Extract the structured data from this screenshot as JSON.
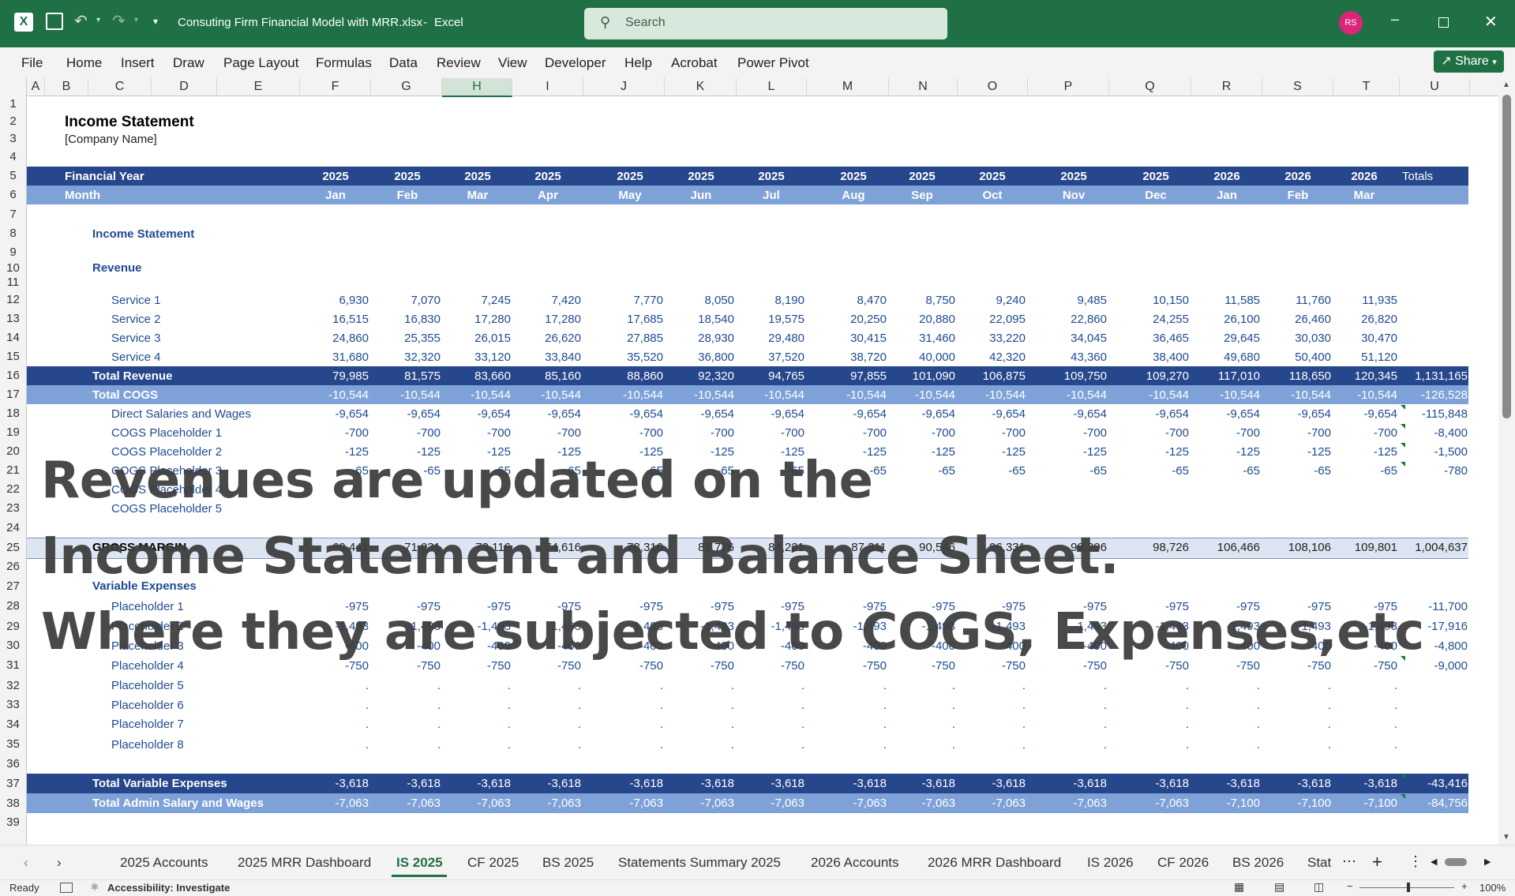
{
  "window": {
    "title": "Consuting Firm Financial Model with MRR.xlsx",
    "app": "Excel",
    "search_placeholder": "Search",
    "user_initials": "RS",
    "brand_color": "#1f7145"
  },
  "ribbon": {
    "tabs": [
      "File",
      "Home",
      "Insert",
      "Draw",
      "Page Layout",
      "Formulas",
      "Data",
      "Review",
      "View",
      "Developer",
      "Help",
      "Acrobat",
      "Power Pivot"
    ],
    "share_label": "Share"
  },
  "grid": {
    "columns": [
      "A",
      "B",
      "C",
      "D",
      "E",
      "F",
      "G",
      "H",
      "I",
      "J",
      "K",
      "L",
      "M",
      "N",
      "O",
      "P",
      "Q",
      "R",
      "S",
      "T",
      "U"
    ],
    "selected_column": "H",
    "rows": [
      "1",
      "2",
      "3",
      "4",
      "5",
      "6",
      "7",
      "8",
      "9",
      "10",
      "11",
      "12",
      "13",
      "14",
      "15",
      "16",
      "17",
      "18",
      "19",
      "20",
      "21",
      "22",
      "23",
      "24",
      "25",
      "26",
      "27",
      "28",
      "29",
      "30",
      "31",
      "32",
      "33",
      "34",
      "35",
      "36",
      "37",
      "38",
      "39"
    ]
  },
  "sheet": {
    "title": "Income Statement",
    "company": "[Company Name]",
    "fy_label": "Financial Year",
    "month_label": "Month",
    "years": [
      "2025",
      "2025",
      "2025",
      "2025",
      "2025",
      "2025",
      "2025",
      "2025",
      "2025",
      "2025",
      "2025",
      "2025",
      "2026",
      "2026",
      "2026"
    ],
    "months": [
      "Jan",
      "Feb",
      "Mar",
      "Apr",
      "May",
      "Jun",
      "Jul",
      "Aug",
      "Sep",
      "Oct",
      "Nov",
      "Dec",
      "Jan",
      "Feb",
      "Mar"
    ],
    "totals_label": "Totals",
    "section_income": "Income Statement",
    "section_revenue": "Revenue",
    "section_variable": "Variable Expenses"
  },
  "table": [
    {
      "label": "Service 1",
      "vals": [
        "6,930",
        "7,070",
        "7,245",
        "7,420",
        "7,770",
        "8,050",
        "8,190",
        "8,470",
        "8,750",
        "9,240",
        "9,485",
        "10,150",
        "11,585",
        "11,760",
        "11,935"
      ],
      "total": ""
    },
    {
      "label": "Service 2",
      "vals": [
        "16,515",
        "16,830",
        "17,280",
        "17,280",
        "17,685",
        "18,540",
        "19,575",
        "20,250",
        "20,880",
        "22,095",
        "22,860",
        "24,255",
        "26,100",
        "26,460",
        "26,820"
      ],
      "total": ""
    },
    {
      "label": "Service 3",
      "vals": [
        "24,860",
        "25,355",
        "26,015",
        "26,620",
        "27,885",
        "28,930",
        "29,480",
        "30,415",
        "31,460",
        "33,220",
        "34,045",
        "36,465",
        "29,645",
        "30,030",
        "30,470"
      ],
      "total": ""
    },
    {
      "label": "Service 4",
      "vals": [
        "31,680",
        "32,320",
        "33,120",
        "33,840",
        "35,520",
        "36,800",
        "37,520",
        "38,720",
        "40,000",
        "42,320",
        "43,360",
        "38,400",
        "49,680",
        "50,400",
        "51,120"
      ],
      "total": ""
    },
    {
      "label": "Total Revenue",
      "vals": [
        "79,985",
        "81,575",
        "83,660",
        "85,160",
        "88,860",
        "92,320",
        "94,765",
        "97,855",
        "101,090",
        "106,875",
        "109,750",
        "109,270",
        "117,010",
        "118,650",
        "120,345"
      ],
      "total": "1,131,165"
    },
    {
      "label": "Total COGS",
      "vals": [
        "-10,544",
        "-10,544",
        "-10,544",
        "-10,544",
        "-10,544",
        "-10,544",
        "-10,544",
        "-10,544",
        "-10,544",
        "-10,544",
        "-10,544",
        "-10,544",
        "-10,544",
        "-10,544",
        "-10,544"
      ],
      "total": "-126,528"
    },
    {
      "label": "Direct Salaries and Wages",
      "vals": [
        "-9,654",
        "-9,654",
        "-9,654",
        "-9,654",
        "-9,654",
        "-9,654",
        "-9,654",
        "-9,654",
        "-9,654",
        "-9,654",
        "-9,654",
        "-9,654",
        "-9,654",
        "-9,654",
        "-9,654"
      ],
      "total": "-115,848"
    },
    {
      "label": "COGS Placeholder 1",
      "vals": [
        "-700",
        "-700",
        "-700",
        "-700",
        "-700",
        "-700",
        "-700",
        "-700",
        "-700",
        "-700",
        "-700",
        "-700",
        "-700",
        "-700",
        "-700"
      ],
      "total": "-8,400"
    },
    {
      "label": "COGS Placeholder 2",
      "vals": [
        "-125",
        "-125",
        "-125",
        "-125",
        "-125",
        "-125",
        "-125",
        "-125",
        "-125",
        "-125",
        "-125",
        "-125",
        "-125",
        "-125",
        "-125"
      ],
      "total": "-1,500"
    },
    {
      "label": "COGS Placeholder 3",
      "vals": [
        "-65",
        "-65",
        "-65",
        "-65",
        "-65",
        "-65",
        "-65",
        "-65",
        "-65",
        "-65",
        "-65",
        "-65",
        "-65",
        "-65",
        "-65"
      ],
      "total": "-780"
    },
    {
      "label": "COGS Placeholder 4",
      "vals": [
        "",
        "",
        "",
        "",
        "",
        "",
        "",
        "",
        "",
        "",
        "",
        "",
        "",
        "",
        ""
      ],
      "total": ""
    },
    {
      "label": "COGS Placeholder 5",
      "vals": [
        "",
        "",
        "",
        "",
        "",
        "",
        "",
        "",
        "",
        "",
        "",
        "",
        "",
        "",
        ""
      ],
      "total": ""
    },
    {
      "label": "GROSS MARGIN",
      "vals": [
        "69,441",
        "71,031",
        "73,116",
        "74,616",
        "78,316",
        "81,776",
        "84,221",
        "87,311",
        "90,546",
        "96,331",
        "99,206",
        "98,726",
        "106,466",
        "108,106",
        "109,801"
      ],
      "total": "1,004,637"
    },
    {
      "label": "Placeholder 1",
      "vals": [
        "-975",
        "-975",
        "-975",
        "-975",
        "-975",
        "-975",
        "-975",
        "-975",
        "-975",
        "-975",
        "-975",
        "-975",
        "-975",
        "-975",
        "-975"
      ],
      "total": "-11,700"
    },
    {
      "label": "Placeholder 2",
      "vals": [
        "-1,493",
        "-1,493",
        "-1,493",
        "-1,493",
        "-1,493",
        "-1,493",
        "-1,493",
        "-1,493",
        "-1,493",
        "-1,493",
        "-1,493",
        "-1,493",
        "-1,493",
        "-1,493",
        "-1,493"
      ],
      "total": "-17,916"
    },
    {
      "label": "Placeholder 3",
      "vals": [
        "-400",
        "-400",
        "-400",
        "-400",
        "-400",
        "-400",
        "-400",
        "-400",
        "-400",
        "-400",
        "-400",
        "-400",
        "-400",
        "-400",
        "-400"
      ],
      "total": "-4,800"
    },
    {
      "label": "Placeholder 4",
      "vals": [
        "-750",
        "-750",
        "-750",
        "-750",
        "-750",
        "-750",
        "-750",
        "-750",
        "-750",
        "-750",
        "-750",
        "-750",
        "-750",
        "-750",
        "-750"
      ],
      "total": "-9,000"
    },
    {
      "label": "Placeholder 5",
      "vals": [
        ".",
        ".",
        ".",
        ".",
        ".",
        ".",
        ".",
        ".",
        ".",
        ".",
        ".",
        ".",
        ".",
        ".",
        "."
      ],
      "total": ""
    },
    {
      "label": "Placeholder 6",
      "vals": [
        ".",
        ".",
        ".",
        ".",
        ".",
        ".",
        ".",
        ".",
        ".",
        ".",
        ".",
        ".",
        ".",
        ".",
        "."
      ],
      "total": ""
    },
    {
      "label": "Placeholder 7",
      "vals": [
        ".",
        ".",
        ".",
        ".",
        ".",
        ".",
        ".",
        ".",
        ".",
        ".",
        ".",
        ".",
        ".",
        ".",
        "."
      ],
      "total": ""
    },
    {
      "label": "Placeholder 8",
      "vals": [
        ".",
        ".",
        ".",
        ".",
        ".",
        ".",
        ".",
        ".",
        ".",
        ".",
        ".",
        ".",
        ".",
        ".",
        "."
      ],
      "total": ""
    },
    {
      "label": "Total Variable Expenses",
      "vals": [
        "-3,618",
        "-3,618",
        "-3,618",
        "-3,618",
        "-3,618",
        "-3,618",
        "-3,618",
        "-3,618",
        "-3,618",
        "-3,618",
        "-3,618",
        "-3,618",
        "-3,618",
        "-3,618",
        "-3,618"
      ],
      "total": "-43,416"
    },
    {
      "label": "Total Admin Salary and Wages",
      "vals": [
        "-7,063",
        "-7,063",
        "-7,063",
        "-7,063",
        "-7,063",
        "-7,063",
        "-7,063",
        "-7,063",
        "-7,063",
        "-7,063",
        "-7,063",
        "-7,063",
        "-7,100",
        "-7,100",
        "-7,100"
      ],
      "total": "-84,756"
    }
  ],
  "overlay": {
    "line1": "Revenues are updated on the",
    "line2": "Income Statement and Balance Sheet.",
    "line3": "Where they are subjected to COGS, Expenses,etc"
  },
  "sheet_tabs": {
    "tabs": [
      "2025 Accounts",
      "2025 MRR Dashboard",
      "IS 2025",
      "CF 2025",
      "BS 2025",
      "Statements Summary 2025",
      "2026 Accounts",
      "2026 MRR Dashboard",
      "IS 2026",
      "CF 2026",
      "BS 2026",
      "Stat"
    ],
    "active": "IS 2025"
  },
  "status": {
    "ready": "Ready",
    "accessibility": "Accessibility: Investigate",
    "zoom": "100%"
  }
}
